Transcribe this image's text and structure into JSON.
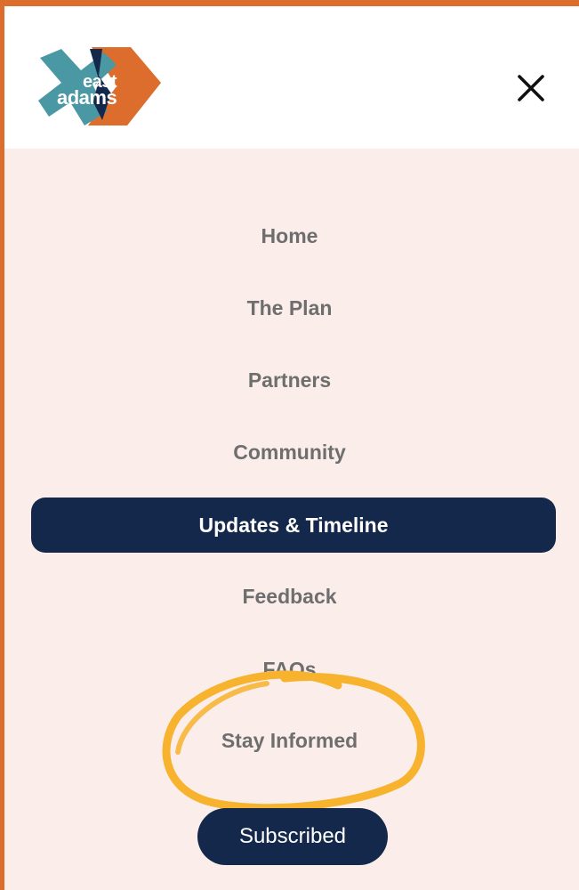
{
  "brand": {
    "line1": "east",
    "line2": "adams",
    "colors": {
      "orange": "#dd6d2c",
      "teal": "#4a98a3",
      "navy": "#14284b"
    }
  },
  "header": {
    "close_icon": "close-icon"
  },
  "nav": {
    "items": [
      {
        "label": "Home"
      },
      {
        "label": "The Plan"
      },
      {
        "label": "Partners"
      },
      {
        "label": "Community"
      },
      {
        "label": "Updates & Timeline",
        "active": true
      },
      {
        "label": "Feedback"
      },
      {
        "label": "FAQs"
      },
      {
        "label": "Stay Informed"
      }
    ]
  },
  "subscribe": {
    "label": "Subscribed"
  },
  "annotation": {
    "color": "#f7b22e"
  }
}
